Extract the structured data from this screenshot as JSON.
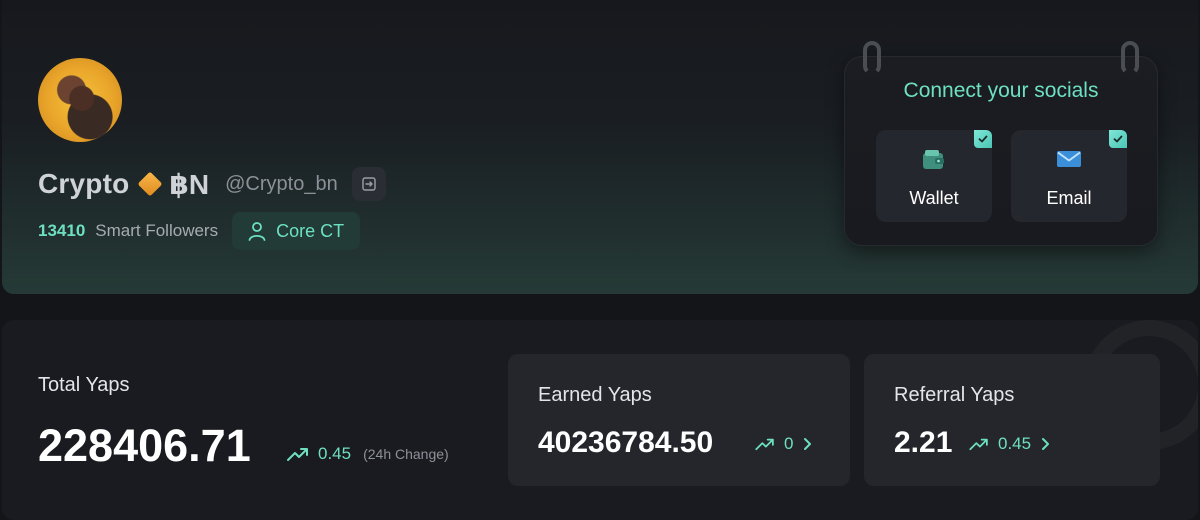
{
  "profile": {
    "display_name": "Crypto",
    "ticker": "฿N",
    "handle": "@Crypto_bn",
    "smart_followers_count": "13410",
    "smart_followers_label": "Smart Followers",
    "badge_label": "Core CT"
  },
  "socials": {
    "title": "Connect your socials",
    "items": [
      {
        "label": "Wallet",
        "icon": "wallet-icon",
        "connected": true
      },
      {
        "label": "Email",
        "icon": "email-icon",
        "connected": true
      }
    ]
  },
  "stats": {
    "total": {
      "label": "Total Yaps",
      "value": "228406.71",
      "change": "0.45",
      "change_note": "(24h Change)"
    },
    "earned": {
      "label": "Earned Yaps",
      "value": "40236784.50",
      "change": "0"
    },
    "referral": {
      "label": "Referral Yaps",
      "value": "2.21",
      "change": "0.45"
    }
  },
  "colors": {
    "accent": "#6de0c2",
    "background": "#141519",
    "card": "#1a1b20",
    "tile": "#24262c"
  }
}
